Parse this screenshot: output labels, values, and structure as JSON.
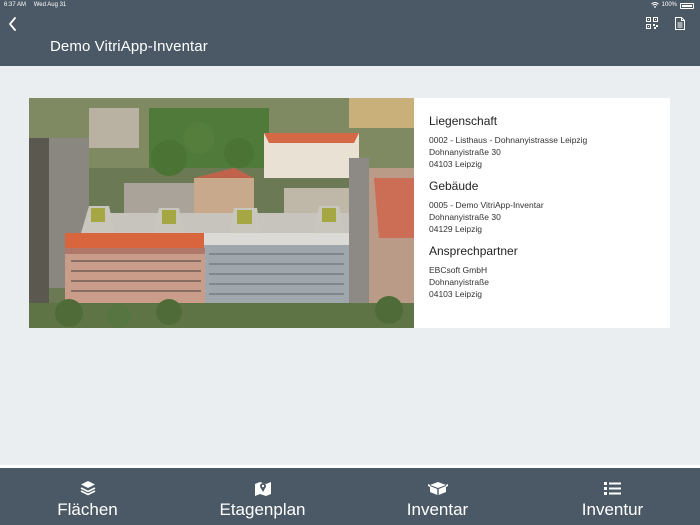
{
  "status_bar": {
    "time": "6:37 AM",
    "date": "Wed Aug 31",
    "battery": "100%"
  },
  "header": {
    "title": "Demo VitriApp-Inventar",
    "icons": [
      "back-icon",
      "qr-code-icon",
      "document-icon"
    ]
  },
  "details": {
    "property": {
      "heading": "Liegenschaft",
      "line1": "0002 - Listhaus - Dohnanyistrasse Leipzig",
      "line2": "Dohnanyistraße 30",
      "line3": "04103 Leipzig"
    },
    "building": {
      "heading": "Gebäude",
      "line1": "0005 - Demo VitriApp-Inventar",
      "line2": "Dohnanyistraße 30",
      "line3": "04129 Leipzig"
    },
    "contact": {
      "heading": "Ansprechpartner",
      "line1": "EBCsoft GmbH",
      "line2": "Dohnanyistraße",
      "line3": "04103 Leipzig"
    }
  },
  "tabs": [
    {
      "label": "Flächen",
      "icon": "layers-icon"
    },
    {
      "label": "Etagenplan",
      "icon": "map-icon"
    },
    {
      "label": "Inventar",
      "icon": "boxes-icon"
    },
    {
      "label": "Inventur",
      "icon": "list-icon"
    }
  ],
  "colors": {
    "header_bg": "#4b5966",
    "page_bg": "#ebeef1",
    "card_bg": "#ffffff"
  }
}
